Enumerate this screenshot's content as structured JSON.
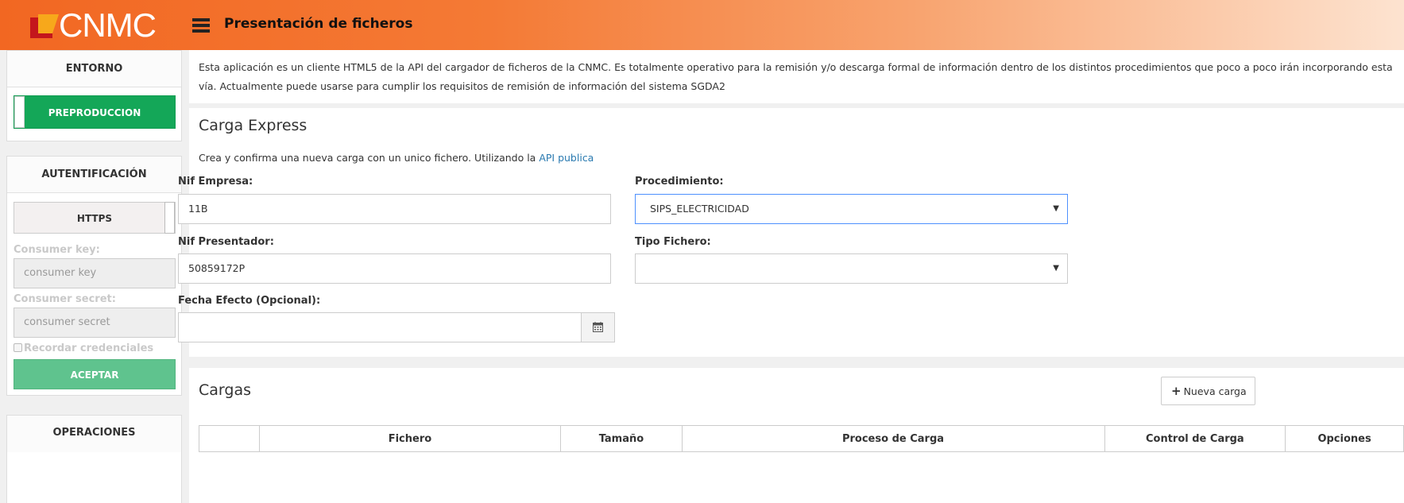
{
  "header": {
    "logo_text": "CNMC",
    "title": "Presentación de ficheros"
  },
  "sidebar": {
    "entorno": {
      "heading": "ENTORNO",
      "toggle_label": "PREPRODUCCION"
    },
    "auth": {
      "heading": "AUTENTIFICACIÓN",
      "toggle_label": "HTTPS",
      "consumer_key_label": "Consumer key:",
      "consumer_key_placeholder": "consumer key",
      "consumer_secret_label": "Consumer secret:",
      "consumer_secret_placeholder": "consumer secret",
      "remember_label": "Recordar credenciales",
      "accept_label": "ACEPTAR"
    },
    "operaciones": {
      "heading": "OPERACIONES"
    }
  },
  "intro": {
    "text": "Esta aplicación es un cliente HTML5 de la API del cargador de ficheros de la CNMC. Es totalmente operativo para la remisión y/o descarga formal de información dentro de los distintos procedimientos que poco a poco irán incorporando esta vía. Actualmente puede usarse para cumplir los requisitos de remisión de información del sistema SGDA2"
  },
  "carga_express": {
    "title": "Carga Express",
    "description": "Crea y confirma una nueva carga con un unico fichero. Utilizando la",
    "api_link": "API publica",
    "nif_empresa_label": "Nif Empresa:",
    "nif_empresa_value": "11B",
    "procedimiento_label": "Procedimiento:",
    "procedimiento_value": "SIPS_ELECTRICIDAD",
    "nif_presentador_label": "Nif Presentador:",
    "nif_presentador_value": "50859172P",
    "tipo_fichero_label": "Tipo Fichero:",
    "tipo_fichero_value": "",
    "fecha_label": "Fecha Efecto (Opcional):",
    "fecha_value": ""
  },
  "cargas": {
    "title": "Cargas",
    "new_button": "Nueva carga",
    "columns": [
      "",
      "Fichero",
      "Tamaño",
      "Proceso de Carga",
      "Control de Carga",
      "Opciones"
    ]
  },
  "icons": {
    "calendar": "calendar-icon",
    "plus": "plus-icon",
    "menu": "hamburger-icon",
    "caret": "caret-down-icon"
  },
  "colors": {
    "brand_orange": "#f26722",
    "env_green": "#14a758",
    "accept_green": "#5fc38e",
    "link_blue": "#2a7ab0"
  }
}
